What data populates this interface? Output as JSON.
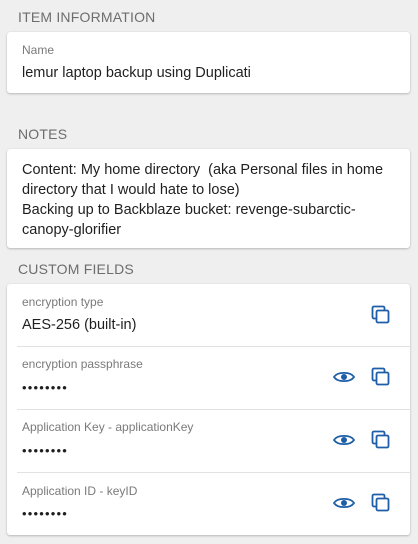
{
  "item_info": {
    "header": "ITEM INFORMATION",
    "name_label": "Name",
    "name_value": "lemur laptop backup using Duplicati"
  },
  "notes": {
    "header": "NOTES",
    "text": "Content: My home directory  (aka Personal files in home directory that I would hate to lose)\nBacking up to Backblaze bucket: revenge-subarctic-canopy-glorifier"
  },
  "custom_fields": {
    "header": "CUSTOM FIELDS",
    "fields": [
      {
        "label": "encryption type",
        "value": "AES-256 (built-in)",
        "hidden": false,
        "icons": [
          "copy-icon"
        ]
      },
      {
        "label": "encryption passphrase",
        "value": "••••••••",
        "hidden": true,
        "icons": [
          "eye-icon",
          "copy-icon"
        ]
      },
      {
        "label": "Application Key - applicationKey",
        "value": "••••••••",
        "hidden": true,
        "icons": [
          "eye-icon",
          "copy-icon"
        ]
      },
      {
        "label": "Application ID - keyID",
        "value": "••••••••",
        "hidden": true,
        "icons": [
          "eye-icon",
          "copy-icon"
        ]
      }
    ]
  },
  "colors": {
    "icon": "#1e5ea8",
    "background": "#efefef",
    "card": "#ffffff",
    "header_text": "#6d6d6d"
  }
}
